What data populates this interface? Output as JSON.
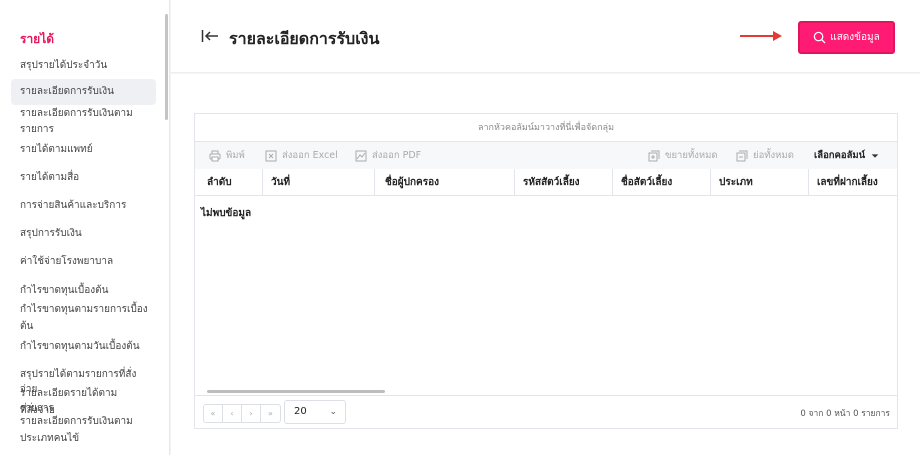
{
  "sidebar": {
    "section": "รายได้",
    "items": [
      "สรุปรายได้ประจำวัน",
      "รายละเอียดการรับเงิน",
      "รายละเอียดการรับเงินตาม",
      "รายการ",
      "รายได้ตามแพทย์",
      "รายได้ตามสื่อ",
      "การจ่ายสินค้าและบริการ",
      "สรุปการรับเงิน",
      "ค่าใช้จ่ายโรงพยาบาล",
      "กำไรขาดทุนเบื้องต้น",
      "กำไรขาดทุนตามรายการเบื้อง",
      "ต้น",
      "กำไรขาดทุนตามวันเบื้องต้น",
      "สรุปรายได้ตามรายการที่สั่งจ่าย",
      "รายละเอียดรายได้ตามรายการ",
      "ที่สั่งจ่าย",
      "รายละเอียดการรับเงินตาม",
      "ประเภทคนไข้"
    ]
  },
  "header": {
    "title": "รายละเอียดการรับเงิน",
    "show_button": "แสดงข้อมูล"
  },
  "grid": {
    "group_hint": "ลากหัวคอลัมน์มาวางที่นี่เพื่อจัดกลุ่ม",
    "toolbar": {
      "print": "พิมพ์",
      "export_excel": "ส่งออก Excel",
      "export_pdf": "ส่งออก PDF",
      "expand_all": "ขยายทั้งหมด",
      "collapse_all": "ย่อทั้งหมด",
      "choose_columns": "เลือกคอลัมน์"
    },
    "columns": [
      "ลำดับ",
      "วันที่",
      "ชื่อผู้ปกครอง",
      "รหัสสัตว์เลี้ยง",
      "ชื่อสัตว์เลี้ยง",
      "ประเภท",
      "เลขที่ฝากเลี้ยง"
    ],
    "empty_text": "ไม่พบข้อมูล",
    "pager": {
      "nav": [
        "«",
        "‹",
        "›",
        "»"
      ],
      "page_size": "20",
      "info": "0 จาก 0 หน้า 0 รายการ"
    }
  },
  "colors": {
    "accent": "#ff1a73",
    "section": "#e6195f",
    "annotation_arrow": "#e53935"
  }
}
